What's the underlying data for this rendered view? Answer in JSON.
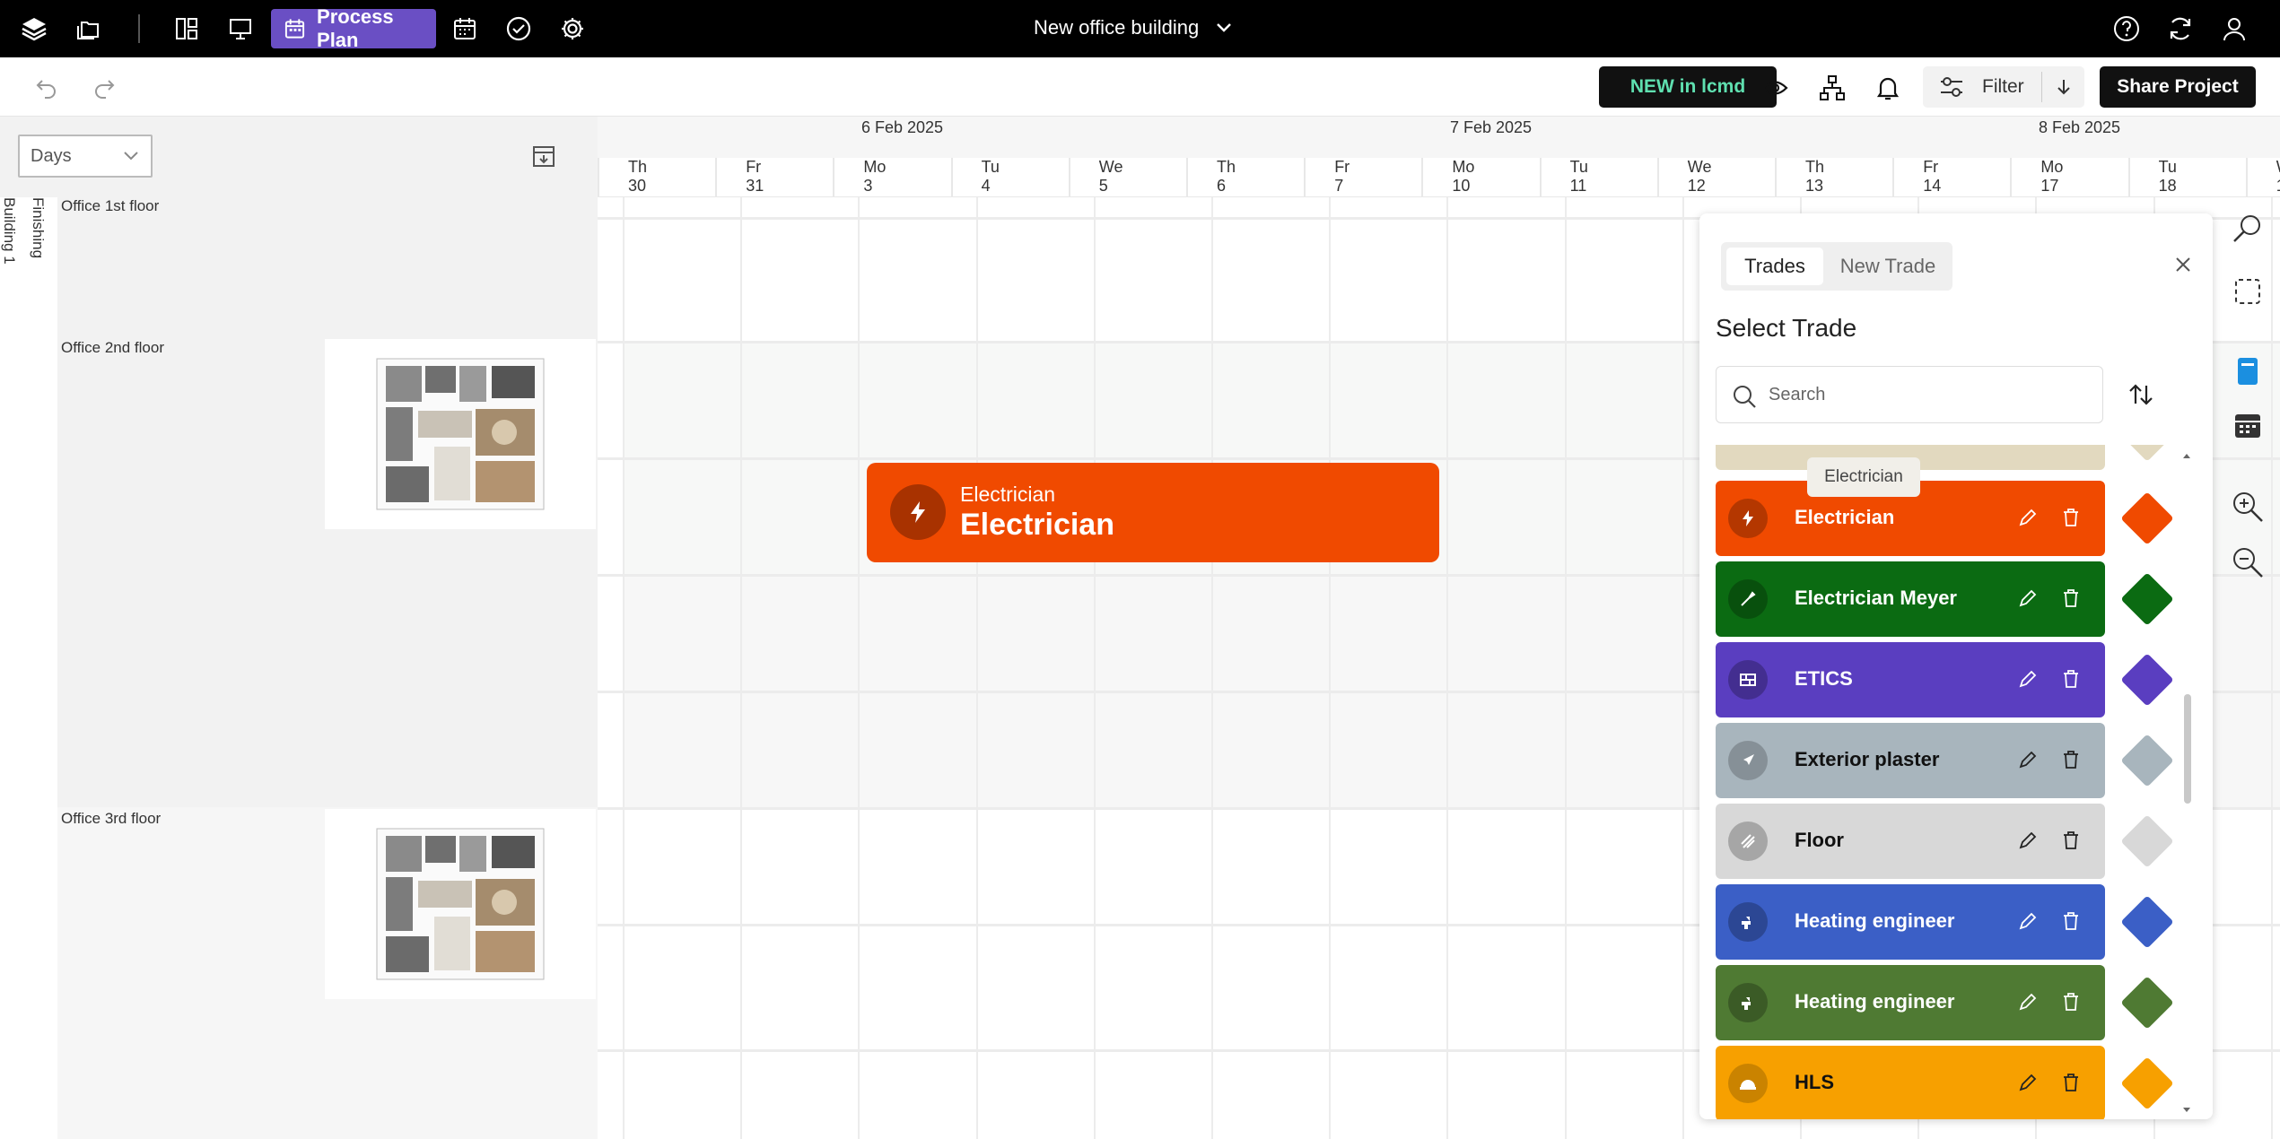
{
  "topbar": {
    "process_plan_label": "Process Plan",
    "project_title": "New office building"
  },
  "toolbar": {
    "new_in_label": "NEW in lcmd",
    "filter_label": "Filter",
    "share_label": "Share Project"
  },
  "left": {
    "view_select": "Days",
    "building_label": "Building 1",
    "phase_label": "Finishing",
    "rows": [
      {
        "label": "Office 1st floor"
      },
      {
        "label": "Office 2nd floor"
      },
      {
        "label": "Office 3rd floor"
      }
    ]
  },
  "timeline": {
    "months": [
      "6 Feb 2025",
      "7 Feb 2025",
      "8 Feb 2025"
    ],
    "days": [
      {
        "dow": "Th",
        "num": "30"
      },
      {
        "dow": "Fr",
        "num": "31"
      },
      {
        "dow": "Mo",
        "num": "3"
      },
      {
        "dow": "Tu",
        "num": "4"
      },
      {
        "dow": "We",
        "num": "5"
      },
      {
        "dow": "Th",
        "num": "6"
      },
      {
        "dow": "Fr",
        "num": "7"
      },
      {
        "dow": "Mo",
        "num": "10"
      },
      {
        "dow": "Tu",
        "num": "11"
      },
      {
        "dow": "We",
        "num": "12"
      },
      {
        "dow": "Th",
        "num": "13"
      },
      {
        "dow": "Fr",
        "num": "14"
      },
      {
        "dow": "Mo",
        "num": "17"
      },
      {
        "dow": "Tu",
        "num": "18"
      },
      {
        "dow": "W",
        "num": "1"
      }
    ],
    "task": {
      "trade": "Electrician",
      "name": "Electrician",
      "color": "#f04a00"
    }
  },
  "panel": {
    "tab_trades": "Trades",
    "tab_new_trade": "New Trade",
    "title": "Select Trade",
    "search_placeholder": "Search",
    "tooltip": "Electrician",
    "trades": [
      {
        "name": "Electrician",
        "color": "#f04a00",
        "icon": "lightning-icon"
      },
      {
        "name": "Electrician Meyer",
        "color": "#0b6b12",
        "icon": "brush-icon"
      },
      {
        "name": "ETICS",
        "color": "#5a3ec0",
        "icon": "brick-icon"
      },
      {
        "name": "Exterior plaster",
        "color": "#a8b5bd",
        "icon": "rocket-icon"
      },
      {
        "name": "Floor",
        "color": "#d8d8d8",
        "icon": "hatch-icon"
      },
      {
        "name": "Heating engineer",
        "color": "#3b5fc6",
        "icon": "faucet-icon"
      },
      {
        "name": "Heating engineer",
        "color": "#4f7a33",
        "icon": "faucet-icon"
      },
      {
        "name": "HLS",
        "color": "#f7a000",
        "icon": "helmet-icon"
      }
    ]
  }
}
